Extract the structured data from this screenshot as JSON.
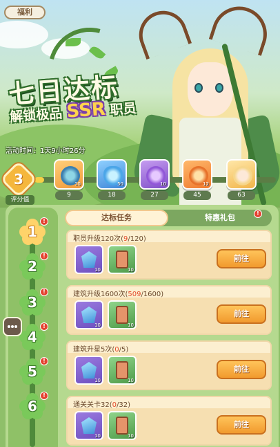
{
  "header": {
    "tab_label": "福利",
    "title": "七日达标",
    "subtitle_pre": "解锁极品",
    "subtitle_ssr": "SSR",
    "subtitle_post": "职员",
    "timer_label": "活动时间：1天9小时26分"
  },
  "score": {
    "value": "3",
    "label": "评分值"
  },
  "progress": {
    "fill_percent": 4
  },
  "rewards": [
    {
      "name": "compass-icon",
      "qty": "10",
      "threshold": "9"
    },
    {
      "name": "potion-blue-icon",
      "qty": "50",
      "threshold": "18"
    },
    {
      "name": "potion-purple-icon",
      "qty": "10",
      "threshold": "27"
    },
    {
      "name": "potion-orange-icon",
      "qty": "12",
      "threshold": "45"
    },
    {
      "name": "character-portrait-icon",
      "qty": "",
      "threshold": "63"
    }
  ],
  "days": [
    "1",
    "2",
    "3",
    "4",
    "5",
    "6"
  ],
  "alert_mark": "!",
  "tabs": {
    "active": "达标任务",
    "other": "特惠礼包"
  },
  "tasks": [
    {
      "label": "职员升级120次(",
      "current": "9",
      "total": "/120)",
      "reward1_qty": "10",
      "reward2_qty": "10",
      "button": "前往"
    },
    {
      "label": "建筑升级1600次(",
      "current": "509",
      "total": "/1600)",
      "reward1_qty": "10",
      "reward2_qty": "10",
      "button": "前往"
    },
    {
      "label": "建筑升星5次(",
      "current": "0",
      "total": "/5)",
      "reward1_qty": "10",
      "reward2_qty": "10",
      "button": "前往"
    },
    {
      "label": "通关关卡32(",
      "current": "0",
      "total": "/32)",
      "reward1_qty": "10",
      "reward2_qty": "10",
      "button": "前往"
    }
  ]
}
